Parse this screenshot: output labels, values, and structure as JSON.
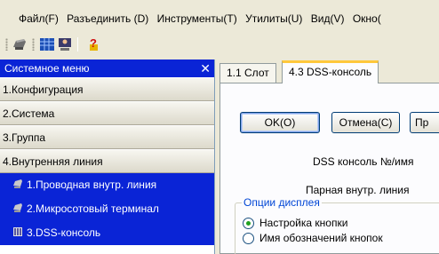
{
  "menubar": {
    "items": [
      "Файл(F)",
      "Разъединить (D)",
      "Инструменты(T)",
      "Утилиты(U)",
      "Вид(V)",
      "Окно("
    ]
  },
  "toolbar": {
    "icons": [
      "phone-icon",
      "grid-icon",
      "user-card-icon",
      "help-icon"
    ]
  },
  "system_menu": {
    "title": "Системное меню",
    "items": [
      {
        "label": "1.Конфигурация"
      },
      {
        "label": "2.Система"
      },
      {
        "label": "3.Группа"
      },
      {
        "label": "4.Внутренняя линия"
      }
    ],
    "subitems": [
      {
        "label": "1.Проводная внутр. линия",
        "icon": "phone-icon"
      },
      {
        "label": "2.Микросотовый терминал",
        "icon": "phone-icon"
      },
      {
        "label": "3.DSS-консоль",
        "icon": "console-icon"
      }
    ]
  },
  "tabs": [
    {
      "label": "1.1 Слот"
    },
    {
      "label": "4.3 DSS-консоль"
    }
  ],
  "buttons": {
    "ok": "OK(O)",
    "cancel": "Отмена(C)",
    "apply": "Пр"
  },
  "form": {
    "console_label": "DSS консоль №/имя",
    "paired_label": "Парная внутр. линия",
    "display_options": {
      "title": "Опции дисплея",
      "options": [
        {
          "label": "Настройка кнопки",
          "selected": true
        },
        {
          "label": "Имя обозначений кнопок",
          "selected": false
        }
      ]
    }
  },
  "colors": {
    "menu_header": "#0a24d6",
    "tab_highlight": "#ffc83c",
    "group_title": "#0046d5"
  }
}
